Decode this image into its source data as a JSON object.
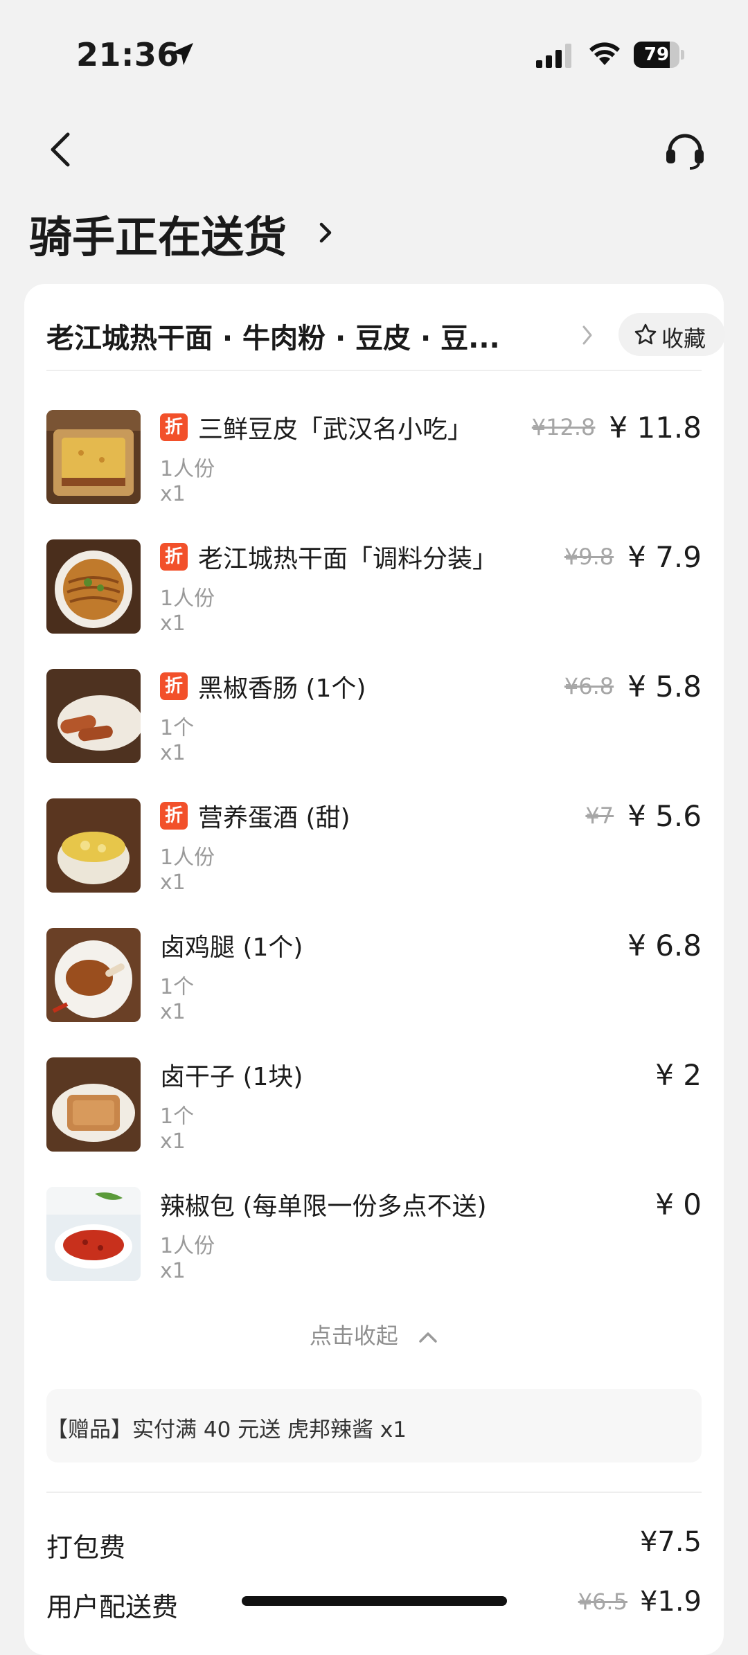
{
  "status_bar": {
    "time": "21:36",
    "battery": "79",
    "battery_level": 0.79
  },
  "header": {
    "title": "骑手正在送货"
  },
  "shop": {
    "name": "老江城热干面 · 牛肉粉 · 豆皮 · 豆...",
    "favorite_label": "收藏"
  },
  "items": [
    {
      "discount_tag": "折",
      "name": "三鲜豆皮「武汉名小吃」",
      "spec": "1人份",
      "qty": "x1",
      "original_price": "¥12.8",
      "price": "¥ 11.8"
    },
    {
      "discount_tag": "折",
      "name": "老江城热干面「调料分装」",
      "spec": "1人份",
      "qty": "x1",
      "original_price": "¥9.8",
      "price": "¥ 7.9"
    },
    {
      "discount_tag": "折",
      "name": "黑椒香肠 (1个)",
      "spec": "1个",
      "qty": "x1",
      "original_price": "¥6.8",
      "price": "¥ 5.8"
    },
    {
      "discount_tag": "折",
      "name": "营养蛋酒 (甜)",
      "spec": "1人份",
      "qty": "x1",
      "original_price": "¥7",
      "price": "¥ 5.6"
    },
    {
      "discount_tag": "",
      "name": "卤鸡腿 (1个)",
      "spec": "1个",
      "qty": "x1",
      "original_price": "",
      "price": "¥ 6.8"
    },
    {
      "discount_tag": "",
      "name": "卤干子 (1块)",
      "spec": "1个",
      "qty": "x1",
      "original_price": "",
      "price": "¥ 2"
    },
    {
      "discount_tag": "",
      "name": "辣椒包 (每单限一份多点不送)",
      "spec": "1人份",
      "qty": "x1",
      "original_price": "",
      "price": "¥ 0"
    }
  ],
  "collapse_label": "点击收起",
  "gift": "【赠品】实付满 40 元送 虎邦辣酱 x1",
  "fees": [
    {
      "label": "打包费",
      "original": "",
      "value": "¥7.5"
    },
    {
      "label": "用户配送费",
      "original": "¥6.5",
      "value": "¥1.9"
    }
  ],
  "colors": {
    "discount_tag": "#f2502a",
    "background": "#f2f2f2",
    "card": "#ffffff"
  }
}
